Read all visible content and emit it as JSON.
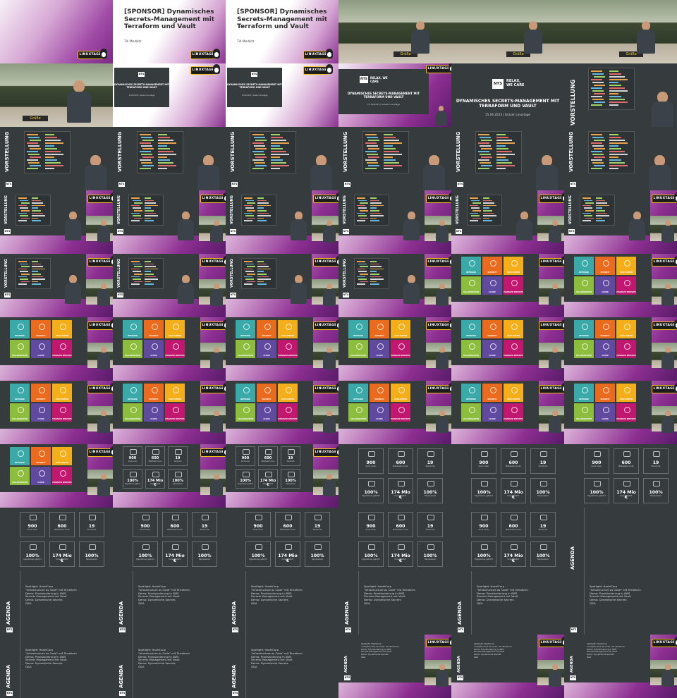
{
  "contact_sheet": {
    "columns": 6,
    "rows": 11,
    "tiles": [
      {
        "kind": "sponsor-title"
      },
      {
        "kind": "sponsor-title-text"
      },
      {
        "kind": "sponsor-title-text"
      },
      {
        "kind": "hall"
      },
      {
        "kind": "hall"
      },
      {
        "kind": "hall"
      },
      {
        "kind": "hall-close"
      },
      {
        "kind": "pres-small"
      },
      {
        "kind": "pres-small"
      },
      {
        "kind": "pres-medium"
      },
      {
        "kind": "pres-full"
      },
      {
        "kind": "intro-full-right"
      },
      {
        "kind": "intro"
      },
      {
        "kind": "intro"
      },
      {
        "kind": "intro"
      },
      {
        "kind": "intro"
      },
      {
        "kind": "intro"
      },
      {
        "kind": "intro"
      },
      {
        "kind": "intro-pip"
      },
      {
        "kind": "intro-pip"
      },
      {
        "kind": "intro-pip"
      },
      {
        "kind": "intro-pip"
      },
      {
        "kind": "intro-pip"
      },
      {
        "kind": "intro-pip"
      },
      {
        "kind": "intro-pip"
      },
      {
        "kind": "intro-pip"
      },
      {
        "kind": "intro-pip"
      },
      {
        "kind": "intro-pip"
      },
      {
        "kind": "squares-pip"
      },
      {
        "kind": "squares-pip"
      },
      {
        "kind": "squares-pip"
      },
      {
        "kind": "squares-pip"
      },
      {
        "kind": "squares-pip"
      },
      {
        "kind": "squares-pip"
      },
      {
        "kind": "squares-pip"
      },
      {
        "kind": "squares-pip"
      },
      {
        "kind": "squares-pip"
      },
      {
        "kind": "squares-pip"
      },
      {
        "kind": "squares-pip"
      },
      {
        "kind": "squares-pip"
      },
      {
        "kind": "squares-pip"
      },
      {
        "kind": "squares-pip"
      },
      {
        "kind": "squares-pip"
      },
      {
        "kind": "stats-pip"
      },
      {
        "kind": "stats-pip"
      },
      {
        "kind": "stats"
      },
      {
        "kind": "stats"
      },
      {
        "kind": "stats"
      },
      {
        "kind": "stats"
      },
      {
        "kind": "stats"
      },
      {
        "kind": "stats"
      },
      {
        "kind": "stats"
      },
      {
        "kind": "stats"
      },
      {
        "kind": "agenda-right"
      },
      {
        "kind": "agenda"
      },
      {
        "kind": "agenda"
      },
      {
        "kind": "agenda"
      },
      {
        "kind": "agenda"
      },
      {
        "kind": "agenda"
      },
      {
        "kind": "agenda-right-cont"
      },
      {
        "kind": "agenda"
      },
      {
        "kind": "agenda"
      },
      {
        "kind": "agenda"
      },
      {
        "kind": "agenda-pip"
      },
      {
        "kind": "agenda-pip"
      },
      {
        "kind": "agenda-pip"
      }
    ]
  },
  "colors": {
    "purple": "#8d2f92",
    "dark_slide": "#363c3e",
    "square_teal": "#3aa9a8",
    "square_orange": "#ea6b1d",
    "square_yellow": "#f4ae1a",
    "square_green": "#8dbd3c",
    "square_violet": "#5f4aa0",
    "square_magenta": "#c2176e"
  },
  "sponsor_slide": {
    "title": "[SPONSOR] Dynamisches Secrets-Management mit Terraform und Vault",
    "author": "Till Merbitz"
  },
  "logos": {
    "linuxtage": "LINUXTAGE",
    "nts": "NTS",
    "nts_tagline": "RELAX, WE CARE",
    "hall_banner": "Grüße"
  },
  "presentation_slide": {
    "title": "DYNAMISCHES SECRETS-MANAGEMENT MIT TERRAFORM UND VAULT",
    "subtitle": "15.04.2023 | Grazer Linuxtage"
  },
  "intro_slide": {
    "label": "VORSTELLUNG"
  },
  "squares_slide": {
    "items": [
      "NETWORK",
      "SECURITY",
      "DATA CENTER",
      "COLLABORATION",
      "CLOUD",
      "MANAGED SERVICES"
    ]
  },
  "stats_slide": {
    "items": [
      {
        "value": "900",
        "label": "Kund:innen",
        "icon": "handshake-icon"
      },
      {
        "value": "600",
        "label": "Mitarbeiter:innen",
        "icon": "team-icon"
      },
      {
        "value": "19",
        "label": "Standorte",
        "icon": "location-pin-icon"
      },
      {
        "value": "100%",
        "label": "Eigentümer geführt",
        "icon": "key-icon"
      },
      {
        "value": "174 Mio €",
        "label": "Umsatz 2021",
        "icon": "chart-icon"
      },
      {
        "value": "100%",
        "label": "Herzensbüro",
        "icon": "heart-icon"
      }
    ]
  },
  "agenda_slide": {
    "label": "AGENDA",
    "items": [
      "Spotlight: HashiCorp",
      "\"Infrastructure as Code\" mit Terraform",
      "Demo: Provisionierung in AWS",
      "Secrets Management mit Vault",
      "Demo: Dynamische Secrets",
      "Q&A"
    ]
  }
}
